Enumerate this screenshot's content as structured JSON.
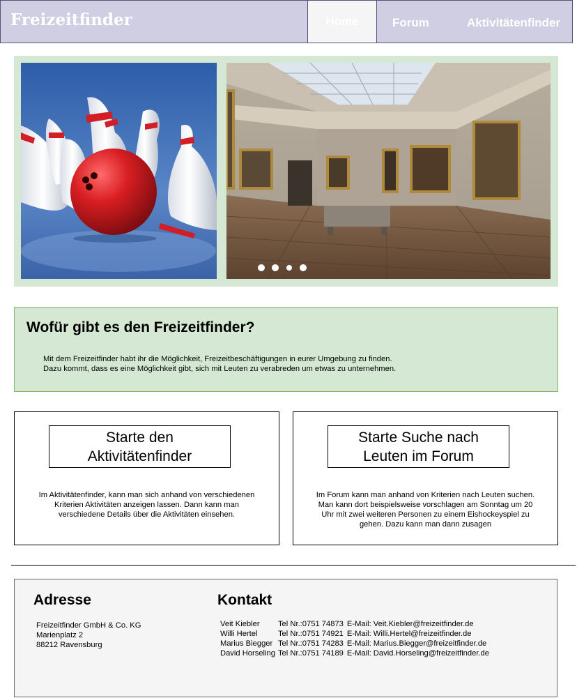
{
  "header": {
    "logo": "Freizeitfinder",
    "nav": [
      "Home",
      "Forum",
      "Aktivitätenfinder"
    ]
  },
  "slider": {
    "slides": [
      "bowling",
      "museum"
    ],
    "dots": 4,
    "active_dot": 3
  },
  "intro": {
    "title": "Wofür gibt es den Freizeitfinder?",
    "line1": "Mit dem Freizeitfinder  habt ihr die Möglichkeit, Freizeitbeschäftigungen in eurer Umgebung zu finden.",
    "line2": "Dazu kommt, dass es eine Möglichkeit gibt, sich mit Leuten zu verabreden um etwas zu unternehmen."
  },
  "cards": {
    "left": {
      "button_line1": "Starte den",
      "button_line2": "Aktivitätenfinder",
      "description": "Im Aktivitätenfinder, kann man sich anhand von verschiedenen Kriterien Aktivitäten anzeigen lassen. Dann kann man verschiedene Details über die Aktivitäten einsehen."
    },
    "right": {
      "button_line1": "Starte Suche nach",
      "button_line2": "Leuten im Forum",
      "description": "Im Forum kann man anhand von Kriterien nach Leuten suchen. Man kann dort beispielsweise vorschlagen am Sonntag um 20 Uhr mit zwei weiteren Personen zu einem Eishockeyspiel zu gehen. Dazu kann man dann zusagen"
    }
  },
  "footer": {
    "address_title": "Adresse",
    "address_lines": [
      "Freizeitfinder GmbH & Co. KG",
      "Marienplatz 2",
      "88212 Ravensburg"
    ],
    "contact_title": "Kontakt",
    "contacts": [
      {
        "name": "Veit Kiebler",
        "tel": "Tel Nr.:0751 74873",
        "email": "E-Mail: Veit.Kiebler@freizeitfinder.de"
      },
      {
        "name": "Willi Hertel",
        "tel": "Tel Nr.:0751 74921",
        "email": "E-Mail: Willi.Hertel@freizeitfinder.de"
      },
      {
        "name": "Marius Biegger",
        "tel": "Tel Nr.:0751 74283",
        "email": "E-Mail: Marius.Biegger@freizeitfinder.de"
      },
      {
        "name": "David Horseling",
        "tel": "Tel Nr.:0751 74189",
        "email": "E-Mail: David.Horseling@freizeitfinder.de"
      }
    ]
  },
  "colors": {
    "header_bg": "#d0cee2",
    "header_border": "#56517e",
    "green_bg": "#d5e8d4",
    "green_border": "#82b366",
    "footer_bg": "#f5f5f5"
  }
}
